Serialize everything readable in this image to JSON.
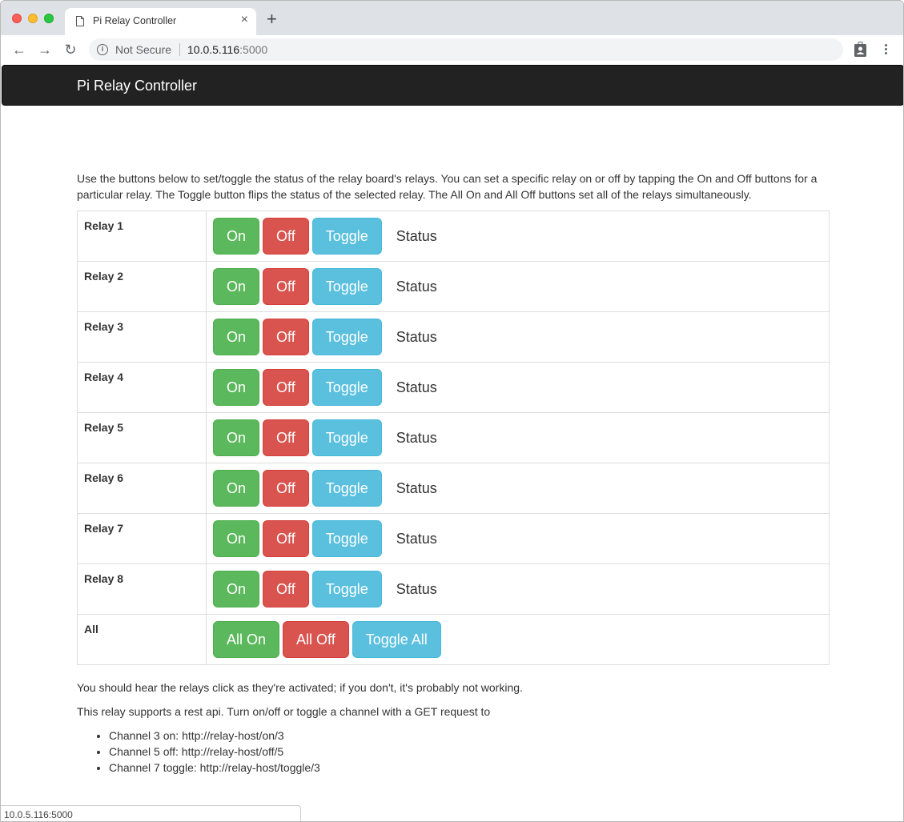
{
  "browser": {
    "tab_title": "Pi Relay Controller",
    "security_label": "Not Secure",
    "url_host": "10.0.5.116",
    "url_port": ":5000",
    "status_bar_url": "10.0.5.116:5000"
  },
  "navbar": {
    "brand": "Pi Relay Controller"
  },
  "intro": "Use the buttons below to set/toggle the status of the relay board's relays. You can set a specific relay on or off by tapping the On and Off buttons for a particular relay. The Toggle button flips the status of the selected relay. The All On and All Off buttons set all of the relays simultaneously.",
  "relays": [
    {
      "label": "Relay 1",
      "on": "On",
      "off": "Off",
      "toggle": "Toggle",
      "status": "Status"
    },
    {
      "label": "Relay 2",
      "on": "On",
      "off": "Off",
      "toggle": "Toggle",
      "status": "Status"
    },
    {
      "label": "Relay 3",
      "on": "On",
      "off": "Off",
      "toggle": "Toggle",
      "status": "Status"
    },
    {
      "label": "Relay 4",
      "on": "On",
      "off": "Off",
      "toggle": "Toggle",
      "status": "Status"
    },
    {
      "label": "Relay 5",
      "on": "On",
      "off": "Off",
      "toggle": "Toggle",
      "status": "Status"
    },
    {
      "label": "Relay 6",
      "on": "On",
      "off": "Off",
      "toggle": "Toggle",
      "status": "Status"
    },
    {
      "label": "Relay 7",
      "on": "On",
      "off": "Off",
      "toggle": "Toggle",
      "status": "Status"
    },
    {
      "label": "Relay 8",
      "on": "On",
      "off": "Off",
      "toggle": "Toggle",
      "status": "Status"
    }
  ],
  "all_row": {
    "label": "All",
    "on": "All On",
    "off": "All Off",
    "toggle": "Toggle All"
  },
  "notes": {
    "hear_clicks": "You should hear the relays click as they're activated; if you don't, it's probably not working.",
    "rest_api": "This relay supports a rest api. Turn on/off or toggle a channel with a GET request to",
    "examples": [
      "Channel 3 on: http://relay-host/on/3",
      "Channel 5 off: http://relay-host/off/5",
      "Channel 7 toggle: http://relay-host/toggle/3"
    ]
  },
  "colors": {
    "success": "#5cb85c",
    "danger": "#d9534f",
    "info": "#5bc0de",
    "navbar": "#222222"
  }
}
